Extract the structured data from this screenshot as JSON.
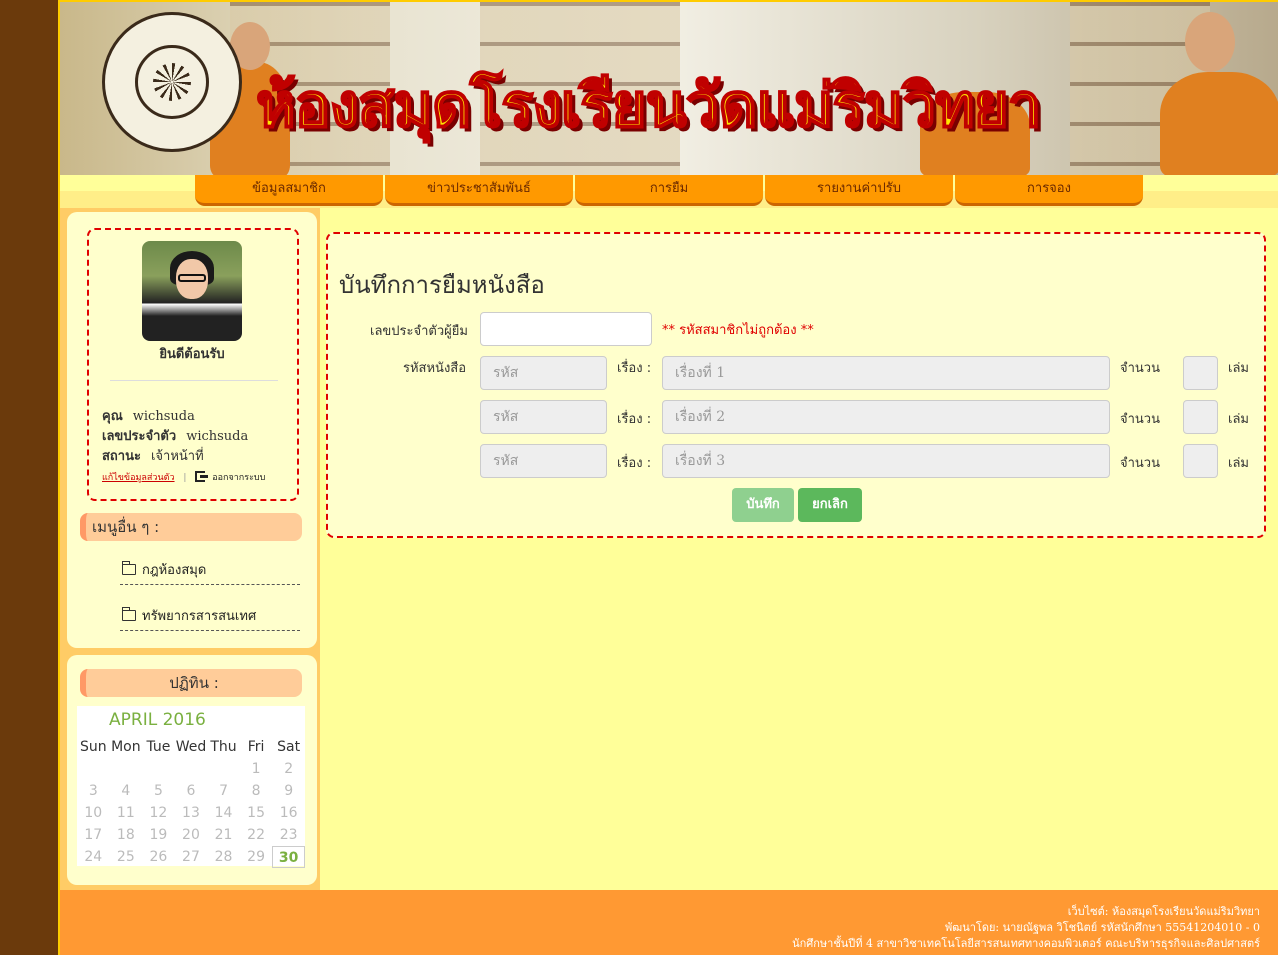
{
  "banner": {
    "title": "ห้องสมุดโรงเรียนวัดแม่ริมวิทยา"
  },
  "nav": {
    "items": [
      "ข้อมูลสมาชิก",
      "ข่าวประชาสัมพันธ์",
      "การยืม",
      "รายงานค่าปรับ",
      "การจอง"
    ]
  },
  "profile": {
    "welcome": "ยินดีต้อนรับ",
    "name_label": "คุณ",
    "name_value": "wichsuda",
    "id_label": "เลขประจำตัว",
    "id_value": "wichsuda",
    "status_label": "สถานะ",
    "status_value": "เจ้าหน้าที่",
    "edit_link": "แก้ไขข้อมูลส่วนตัว",
    "logout_link": "ออกจากระบบ"
  },
  "other_menu": {
    "title": "เมนูอื่น ๆ :",
    "items": [
      "กฎห้องสมุด",
      "ทรัพยากรสารสนเทศ"
    ]
  },
  "calendar": {
    "title": "ปฏิทิน :",
    "month": "APRIL 2016",
    "weekdays": [
      "Sun",
      "Mon",
      "Tue",
      "Wed",
      "Thu",
      "Fri",
      "Sat"
    ],
    "weeks": [
      [
        "",
        "",
        "",
        "",
        "",
        "1",
        "2"
      ],
      [
        "3",
        "4",
        "5",
        "6",
        "7",
        "8",
        "9"
      ],
      [
        "10",
        "11",
        "12",
        "13",
        "14",
        "15",
        "16"
      ],
      [
        "17",
        "18",
        "19",
        "20",
        "21",
        "22",
        "23"
      ],
      [
        "24",
        "25",
        "26",
        "27",
        "28",
        "29",
        "30"
      ]
    ],
    "today": "30"
  },
  "form": {
    "title": "บันทึกการยืมหนังสือ",
    "borrower_label": "เลขประจำตัวผู้ยืม",
    "borrower_value": "",
    "error": "** รหัสสมาชิกไม่ถูกต้อง **",
    "book_code_label": "รหัสหนังสือ",
    "story_label": "เรื่อง :",
    "qty_label": "จำนวน",
    "unit_label": "เล่ม",
    "rows": [
      {
        "code_placeholder": "รหัส",
        "title_placeholder": "เรื่องที่ 1"
      },
      {
        "code_placeholder": "รหัส",
        "title_placeholder": "เรื่องที่ 2"
      },
      {
        "code_placeholder": "รหัส",
        "title_placeholder": "เรื่องที่ 3"
      }
    ],
    "save_button": "บันทึก",
    "cancel_button": "ยกเลิก"
  },
  "footer": {
    "line1": "เว็บไซต์: ห้องสมุดโรงเรียนวัดแม่ริมวิทยา",
    "line2": "พัฒนาโดย: นายณัฐพล วิโชนิตย์ รหัสนักศึกษา 55541204010 - 0",
    "line3": "นักศึกษาชั้นปีที่ 4 สาขาวิชาเทคโนโลยีสารสนเทศทางคอมพิวเตอร์ คณะบริหารธุรกิจและศิลปศาสตร์"
  },
  "colors": {
    "background": "#6b3a0c",
    "page": "#ffff99",
    "nav": "#ff9900",
    "error": "#e00000",
    "button": "#5cb85c"
  }
}
